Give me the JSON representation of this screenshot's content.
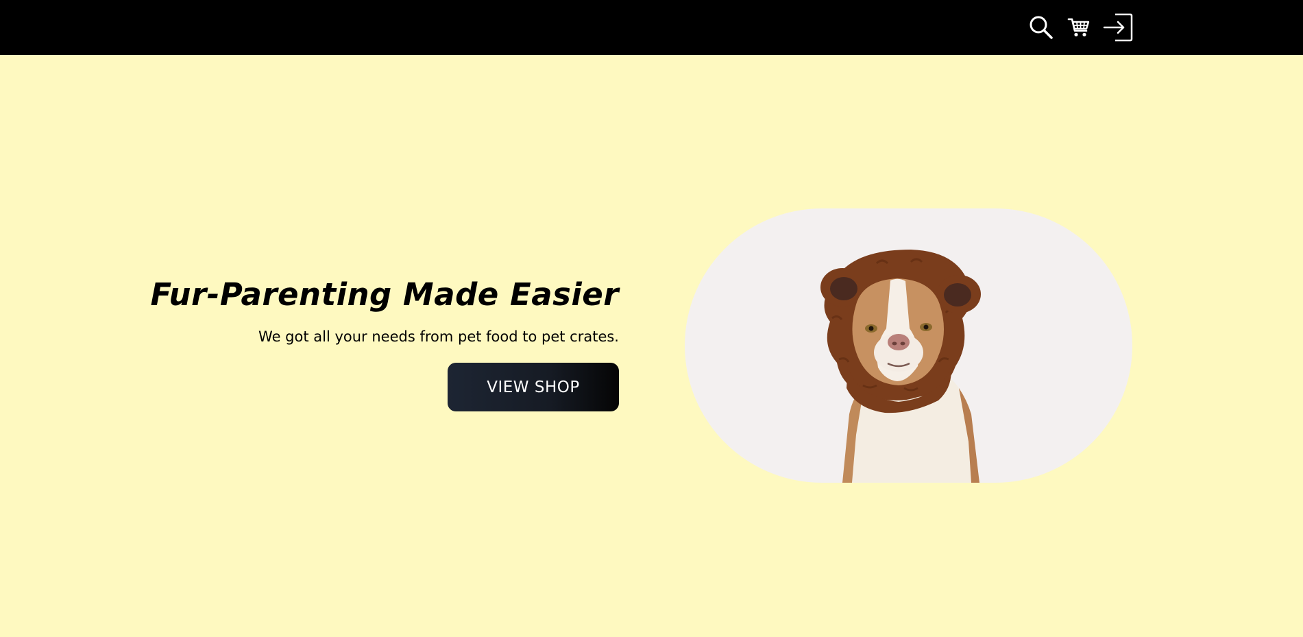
{
  "header": {
    "icons": {
      "search": "search-icon",
      "cart": "cart-icon",
      "login": "login-icon"
    }
  },
  "hero": {
    "title": "Fur-Parenting Made Easier",
    "subtitle": "We got all your needs from pet food to pet crates.",
    "cta_label": "VIEW SHOP",
    "image_alt": "dog wearing bear hood"
  },
  "colors": {
    "background": "#fef9c0",
    "header": "#000000",
    "button": "#161b24",
    "image_bg": "#f3f0f0"
  }
}
